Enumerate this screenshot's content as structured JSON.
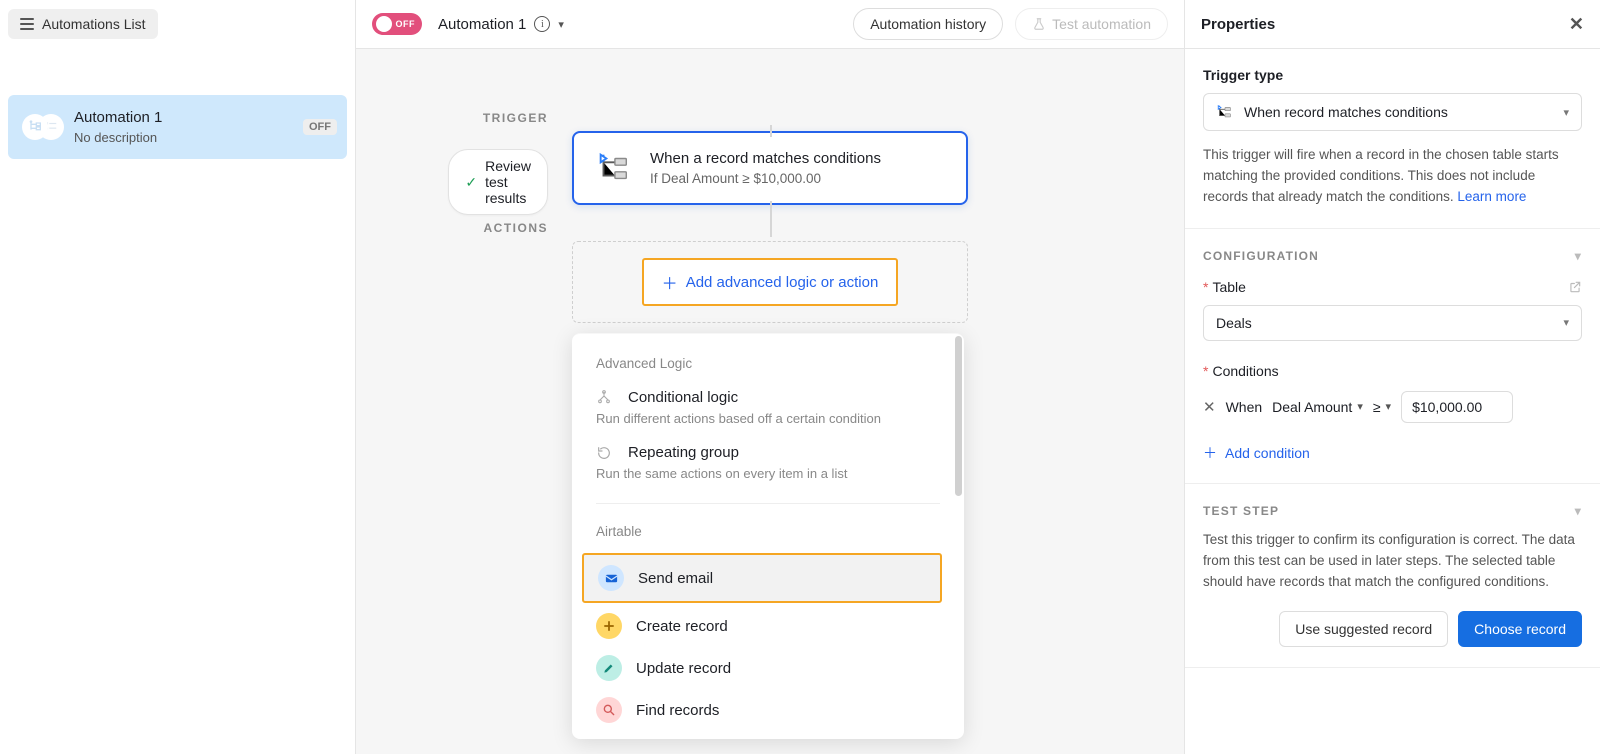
{
  "sidebar": {
    "list_button": "Automations List",
    "card": {
      "title": "Automation 1",
      "subtitle": "No description",
      "badge": "OFF"
    }
  },
  "topbar": {
    "toggle_label": "OFF",
    "name": "Automation 1",
    "history_btn": "Automation history",
    "test_btn": "Test automation"
  },
  "canvas": {
    "trigger_label": "TRIGGER",
    "actions_label": "ACTIONS",
    "review_pill": "Review test results",
    "trigger_node": {
      "title": "When a record matches conditions",
      "subtitle": "If Deal Amount ≥ $10,000.00"
    },
    "add_action_btn": "Add advanced logic or action",
    "menu": {
      "group1_header": "Advanced Logic",
      "conditional": {
        "title": "Conditional logic",
        "desc": "Run different actions based off a certain condition"
      },
      "repeating": {
        "title": "Repeating group",
        "desc": "Run the same actions on every item in a list"
      },
      "group2_header": "Airtable",
      "send_email": "Send email",
      "create_record": "Create record",
      "update_record": "Update record",
      "find_records": "Find records"
    }
  },
  "properties": {
    "title": "Properties",
    "trigger_type_label": "Trigger type",
    "trigger_type_value": "When record matches conditions",
    "trigger_desc": "This trigger will fire when a record in the chosen table starts matching the provided conditions. This does not include records that already match the conditions.",
    "learn_more": "Learn more",
    "config_header": "CONFIGURATION",
    "table_label": "Table",
    "table_value": "Deals",
    "conditions_label": "Conditions",
    "cond_when": "When",
    "cond_field": "Deal Amount",
    "cond_op": "≥",
    "cond_value": "$10,000.00",
    "add_condition": "Add condition",
    "test_header": "TEST STEP",
    "test_desc": "Test this trigger to confirm its configuration is correct. The data from this test can be used in later steps. The selected table should have records that match the configured conditions.",
    "use_suggested": "Use suggested record",
    "choose_record": "Choose record"
  }
}
